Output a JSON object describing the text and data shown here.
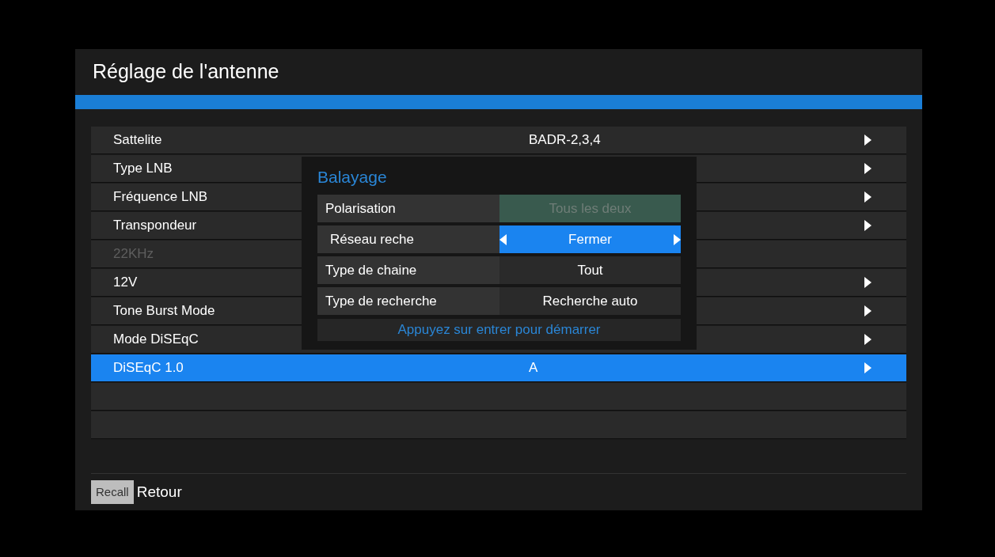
{
  "title": "Réglage de l'antenne",
  "rows": [
    {
      "kind": "item",
      "label": "Sattelite",
      "value": "BADR-2,3,4",
      "arrow": true,
      "disabled": false,
      "selected": false
    },
    {
      "kind": "item",
      "label": "Type LNB",
      "arrow": true,
      "disabled": false,
      "selected": false
    },
    {
      "kind": "item",
      "label": "Fréquence LNB",
      "arrow": true,
      "disabled": false,
      "selected": false
    },
    {
      "kind": "item",
      "label": "Transpondeur",
      "arrow": true,
      "disabled": false,
      "selected": false
    },
    {
      "kind": "item",
      "label": "22KHz",
      "arrow": false,
      "disabled": true,
      "selected": false
    },
    {
      "kind": "item",
      "label": "12V",
      "arrow": true,
      "disabled": false,
      "selected": false
    },
    {
      "kind": "item",
      "label": "Tone Burst Mode",
      "arrow": true,
      "disabled": false,
      "selected": false
    },
    {
      "kind": "item",
      "label": "Mode DiSEqC",
      "arrow": true,
      "disabled": false,
      "selected": false
    },
    {
      "kind": "item",
      "label": "DiSEqC 1.0",
      "value": "A",
      "arrow": true,
      "disabled": false,
      "selected": true
    },
    {
      "kind": "empty"
    },
    {
      "kind": "empty"
    }
  ],
  "dialog": {
    "title": "Balayage",
    "rows": [
      {
        "label": "Polarisation",
        "value": "Tous les deux",
        "disabled": true,
        "selected": false
      },
      {
        "label": "Réseau reche",
        "value": "Fermer",
        "disabled": false,
        "selected": true
      },
      {
        "label": "Type de chaine",
        "value": "Tout",
        "disabled": false,
        "selected": false
      },
      {
        "label": "Type de recherche",
        "value": "Recherche auto",
        "disabled": false,
        "selected": false
      }
    ],
    "hint": "Appuyez sur entrer pour démarrer"
  },
  "footer": {
    "key": "Recall",
    "label": "Retour"
  }
}
